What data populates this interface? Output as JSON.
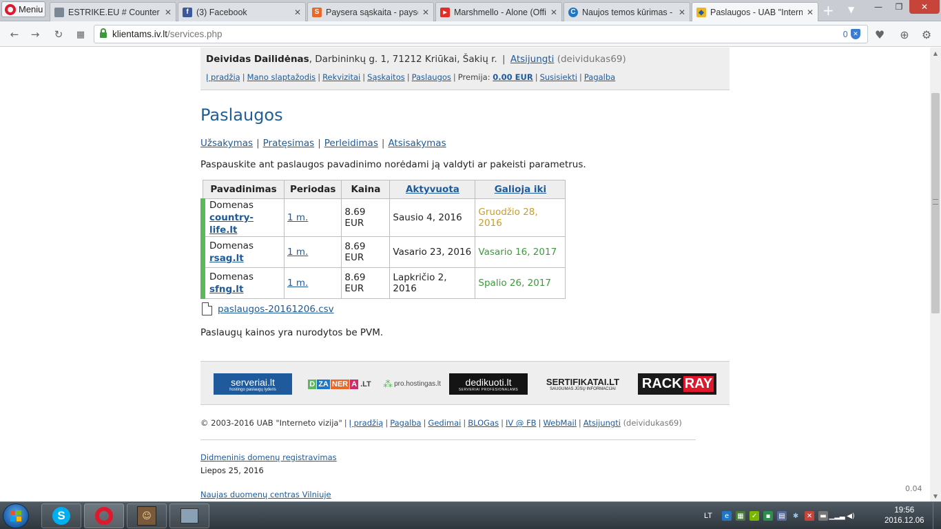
{
  "browser": {
    "menu_label": "Meniu",
    "tabs": [
      {
        "title": "ESTRIKE.EU # Counter Strike",
        "favicon": "document-icon",
        "color": "#7a8794"
      },
      {
        "title": "(3) Facebook",
        "favicon": "facebook-icon",
        "color": "#3b5998"
      },
      {
        "title": "Paysera sąskaita - paysera",
        "favicon": "paysera-icon",
        "color": "#e8682a"
      },
      {
        "title": "Marshmello - Alone (Official",
        "favicon": "youtube-icon",
        "color": "#e52d27"
      },
      {
        "title": "Naujos temos kūrimas - Sk",
        "favicon": "forum-icon",
        "color": "#1f76c5"
      },
      {
        "title": "Paslaugos - UAB \"Interneto",
        "favicon": "iv-icon",
        "color": "#1f5e96"
      }
    ],
    "url_domain": "klientams.iv.lt",
    "url_path": "/services.php",
    "adblock_count": "0"
  },
  "account": {
    "name": "Deividas Dailidėnas",
    "address": ", Darbininkų g. 1, 71212 Kriūkai, Šakių r.",
    "logout": "Atsijungti",
    "login": "(deividukas69)"
  },
  "top_nav": {
    "items": [
      "Į pradžią",
      "Mano slaptažodis",
      "Rekvizitai",
      "Sąskaitos",
      "Paslaugos"
    ],
    "bonus_label": "Premija:",
    "bonus_value": "0.00 EUR",
    "contact": "Susisiekti",
    "help": "Pagalba"
  },
  "page": {
    "title": "Paslaugos",
    "actions": [
      "Užsakymas",
      "Pratęsimas",
      "Perleidimas",
      "Atsisakymas"
    ],
    "instruction": "Paspauskite ant paslaugos pavadinimo norėdami ją valdyti ar pakeisti parametrus.",
    "csv_file": "paslaugos-20161206.csv",
    "vat_note": "Paslaugų kainos yra nurodytos be PVM."
  },
  "table": {
    "headers": {
      "name": "Pavadinimas",
      "period": "Periodas",
      "price": "Kaina",
      "activated": "Aktyvuota",
      "valid": "Galioja iki"
    },
    "rows": [
      {
        "type": "Domenas",
        "domain": "country-life.lt",
        "period": "1 m.",
        "price": "8.69 EUR",
        "activated": "Sausio 4, 2016",
        "valid": "Gruodžio 28, 2016",
        "status": "warn"
      },
      {
        "type": "Domenas",
        "domain": "rsag.lt",
        "period": "1 m.",
        "price": "8.69 EUR",
        "activated": "Vasario 23, 2016",
        "valid": "Vasario 16, 2017",
        "status": "ok"
      },
      {
        "type": "Domenas",
        "domain": "sfng.lt",
        "period": "1 m.",
        "price": "8.69 EUR",
        "activated": "Lapkričio 2, 2016",
        "valid": "Spalio 26, 2017",
        "status": "ok"
      }
    ]
  },
  "partners": {
    "serveriai": "serveriai.lt",
    "serveriai_sub": "hostingo paslaugų lyderis",
    "dzanera": [
      "D",
      "ZA",
      "NER",
      "A",
      ".LT"
    ],
    "prohostingas": "pro.hostingas.lt",
    "dedikuoti": "dedikuoti.lt",
    "dedikuoti_sub": "SERVERIAI PROFESIONALAMS",
    "sertifikatai": "SERTIFIKATAI.LT",
    "sertifikatai_sub": "SAUGUMAS JŪSŲ INFORMACIJAI",
    "rackray_a": "RACK",
    "rackray_b": "RAY"
  },
  "footer": {
    "copyright": "© 2003-2016 UAB \"Interneto vizija\"",
    "links": [
      "Į pradžią",
      "Pagalba",
      "Gedimai",
      "BLOGas",
      "IV @ FB",
      "WebMail",
      "Atsijungti"
    ],
    "login": "(deividukas69)"
  },
  "news": [
    {
      "title": "Didmeninis domenų registravimas",
      "date": "Liepos 25, 2016"
    },
    {
      "title": "Naujas duomenų centras Vilniuje",
      "date": ""
    }
  ],
  "load_time": "0.04",
  "taskbar": {
    "lang": "LT",
    "time": "19:56",
    "date": "2016.12.06"
  },
  "colors": {
    "brand_blue": "#1f5e96",
    "link": "#1e5a9a",
    "active_green": "#5cb85c",
    "expiring": "#cb9a2a",
    "valid": "#3b9a3b"
  }
}
